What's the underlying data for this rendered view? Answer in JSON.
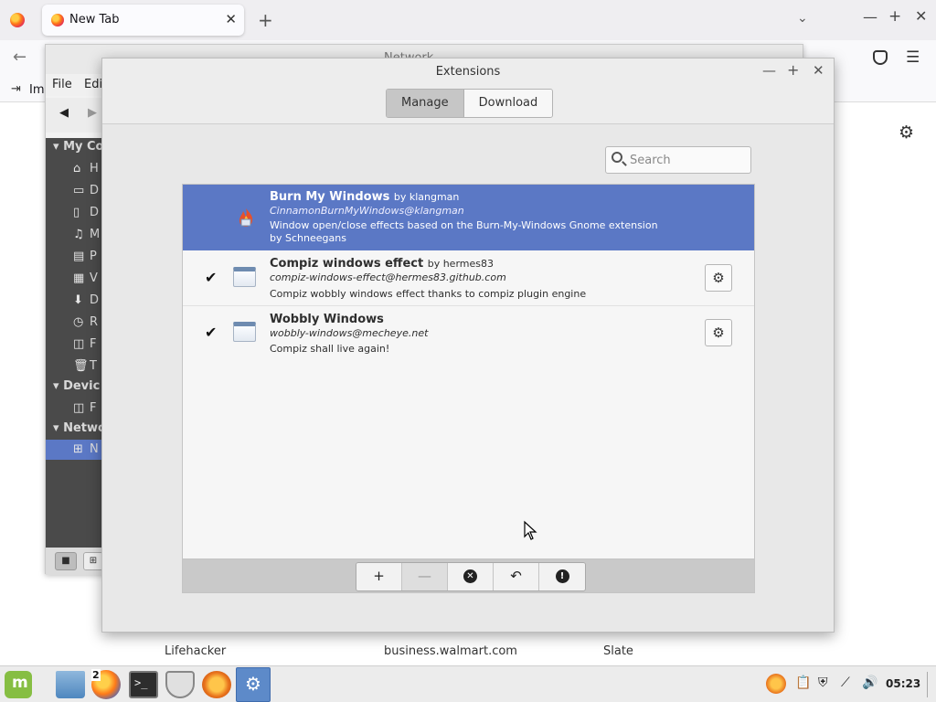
{
  "firefox": {
    "tab_title": "New Tab",
    "tab_close": "✕",
    "new_tab": "+",
    "list_all_tabs": "⌄",
    "minimize": "—",
    "maximize": "+",
    "close": "✕",
    "back": "←",
    "menu": "☰",
    "import_icon": "⇥",
    "import_label": "Imp",
    "gear": "⚙",
    "tiles": [
      "Lifehacker",
      "business.walmart.com",
      "Slate"
    ]
  },
  "file_manager": {
    "title": "Network",
    "menus": [
      "File",
      "Edi"
    ],
    "back_arrow": "◀",
    "forward_arrow": "▶",
    "sections": {
      "my_computer": "My Co",
      "devices": "Devic",
      "network": "Netwo"
    },
    "items": [
      {
        "icon": "⌂",
        "label": "H"
      },
      {
        "icon": "▭",
        "label": "D"
      },
      {
        "icon": "▯",
        "label": "D"
      },
      {
        "icon": "♫",
        "label": "M"
      },
      {
        "icon": "▤",
        "label": "P"
      },
      {
        "icon": "▦",
        "label": "V"
      },
      {
        "icon": "⬇",
        "label": "D"
      },
      {
        "icon": "◷",
        "label": "R"
      },
      {
        "icon": "◫",
        "label": "F"
      },
      {
        "icon": "🗑",
        "label": "T"
      }
    ],
    "device_item": {
      "icon": "◫",
      "label": "F"
    },
    "network_item": {
      "icon": "⊞",
      "label": "N"
    },
    "bottom_a": "■",
    "bottom_b": "⊞"
  },
  "extensions": {
    "title": "Extensions",
    "minimize": "—",
    "maximize": "+",
    "close": "✕",
    "tabs": {
      "manage": "Manage",
      "download": "Download"
    },
    "search_placeholder": "Search",
    "rows": [
      {
        "name": "Burn My Windows",
        "by": "by klangman",
        "uuid": "CinnamonBurnMyWindows@klangman",
        "description": "Window open/close effects based on the Burn-My-Windows Gnome extension by Schneegans",
        "enabled": false,
        "selected": true
      },
      {
        "name": "Compiz windows effect",
        "by": "by hermes83",
        "uuid": "compiz-windows-effect@hermes83.github.com",
        "description": "Compiz wobbly windows effect thanks to compiz plugin engine",
        "enabled": true,
        "check": "✔",
        "config": "⚙"
      },
      {
        "name": "Wobbly Windows",
        "by": "",
        "uuid": "wobbly-windows@mecheye.net",
        "description": "Compiz shall live again!",
        "enabled": true,
        "check": "✔",
        "config": "⚙"
      }
    ],
    "actions": {
      "add": "+",
      "remove": "—",
      "uninstall": "✕",
      "restore": "↶",
      "about": "!"
    }
  },
  "taskbar": {
    "menu_glyph": "m",
    "terminal_glyph": ">_",
    "firefox_window_count": "2",
    "settings_glyph": "⚙",
    "tray": {
      "clipboard": "📋",
      "shield": "⛨",
      "network": "⟋",
      "volume": "🔊"
    },
    "clock": "05:23"
  },
  "colors": {
    "selection": "#5b78c5",
    "mint_green": "#86be43"
  }
}
